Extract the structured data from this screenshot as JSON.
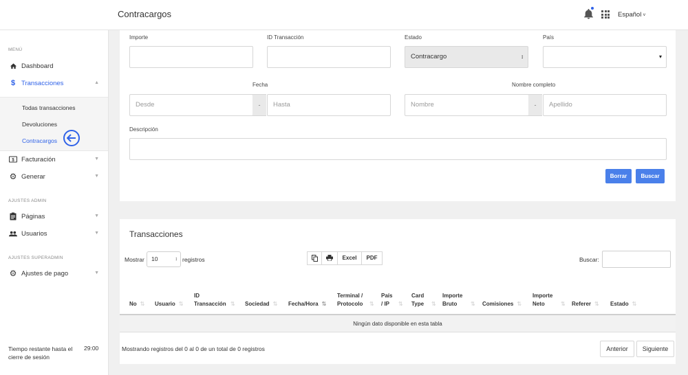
{
  "header": {
    "title": "Contracargos",
    "language": "Español"
  },
  "sidebar": {
    "menu_label": "MENÚ",
    "items": [
      {
        "label": "Dashboard"
      },
      {
        "label": "Transacciones"
      },
      {
        "label": "Facturación"
      },
      {
        "label": "Generar"
      },
      {
        "label": "Páginas"
      },
      {
        "label": "Usuarios"
      },
      {
        "label": "Ajustes de pago"
      }
    ],
    "sub_items": [
      {
        "label": "Todas transacciones"
      },
      {
        "label": "Devoluciones"
      },
      {
        "label": "Contracargos"
      }
    ],
    "admin_label": "AJUSTES ADMIN",
    "superadmin_label": "AJUSTES SUPERADMIN",
    "session_text": "Tiempo restante hasta el cierre de sesión",
    "session_time": "29:00"
  },
  "filters": {
    "importe_label": "Importe",
    "id_label": "ID Transacción",
    "estado_label": "Estado",
    "estado_value": "Contracargo",
    "pais_label": "País",
    "fecha_label": "Fecha",
    "desde_placeholder": "Desde",
    "hasta_placeholder": "Hasta",
    "nombre_completo_label": "Nombre completo",
    "nombre_placeholder": "Nombre",
    "apellido_placeholder": "Apellido",
    "range_sep": "-",
    "descripcion_label": "Descripción",
    "borrar_label": "Borrar",
    "buscar_label": "Buscar"
  },
  "table": {
    "title": "Transacciones",
    "show_label": "Mostrar",
    "length_value": "10",
    "records_label": "registros",
    "excel_label": "Excel",
    "pdf_label": "PDF",
    "search_label": "Buscar:",
    "columns": [
      "No",
      "Usuario",
      "ID Transacción",
      "Sociedad",
      "Fecha/Hora",
      "Terminal / Protocolo",
      "País / IP",
      "Card Type",
      "Importe Bruto",
      "Comisiones",
      "Importe Neto",
      "Referer",
      "Estado"
    ],
    "empty_text": "Ningún dato disponible en esta tabla",
    "info_text": "Mostrando registros del 0 al 0 de un total de 0 registros",
    "prev_label": "Anterior",
    "next_label": "Siguiente"
  },
  "colors": {
    "accent": "#2f62e8",
    "button": "#4a80ea"
  }
}
